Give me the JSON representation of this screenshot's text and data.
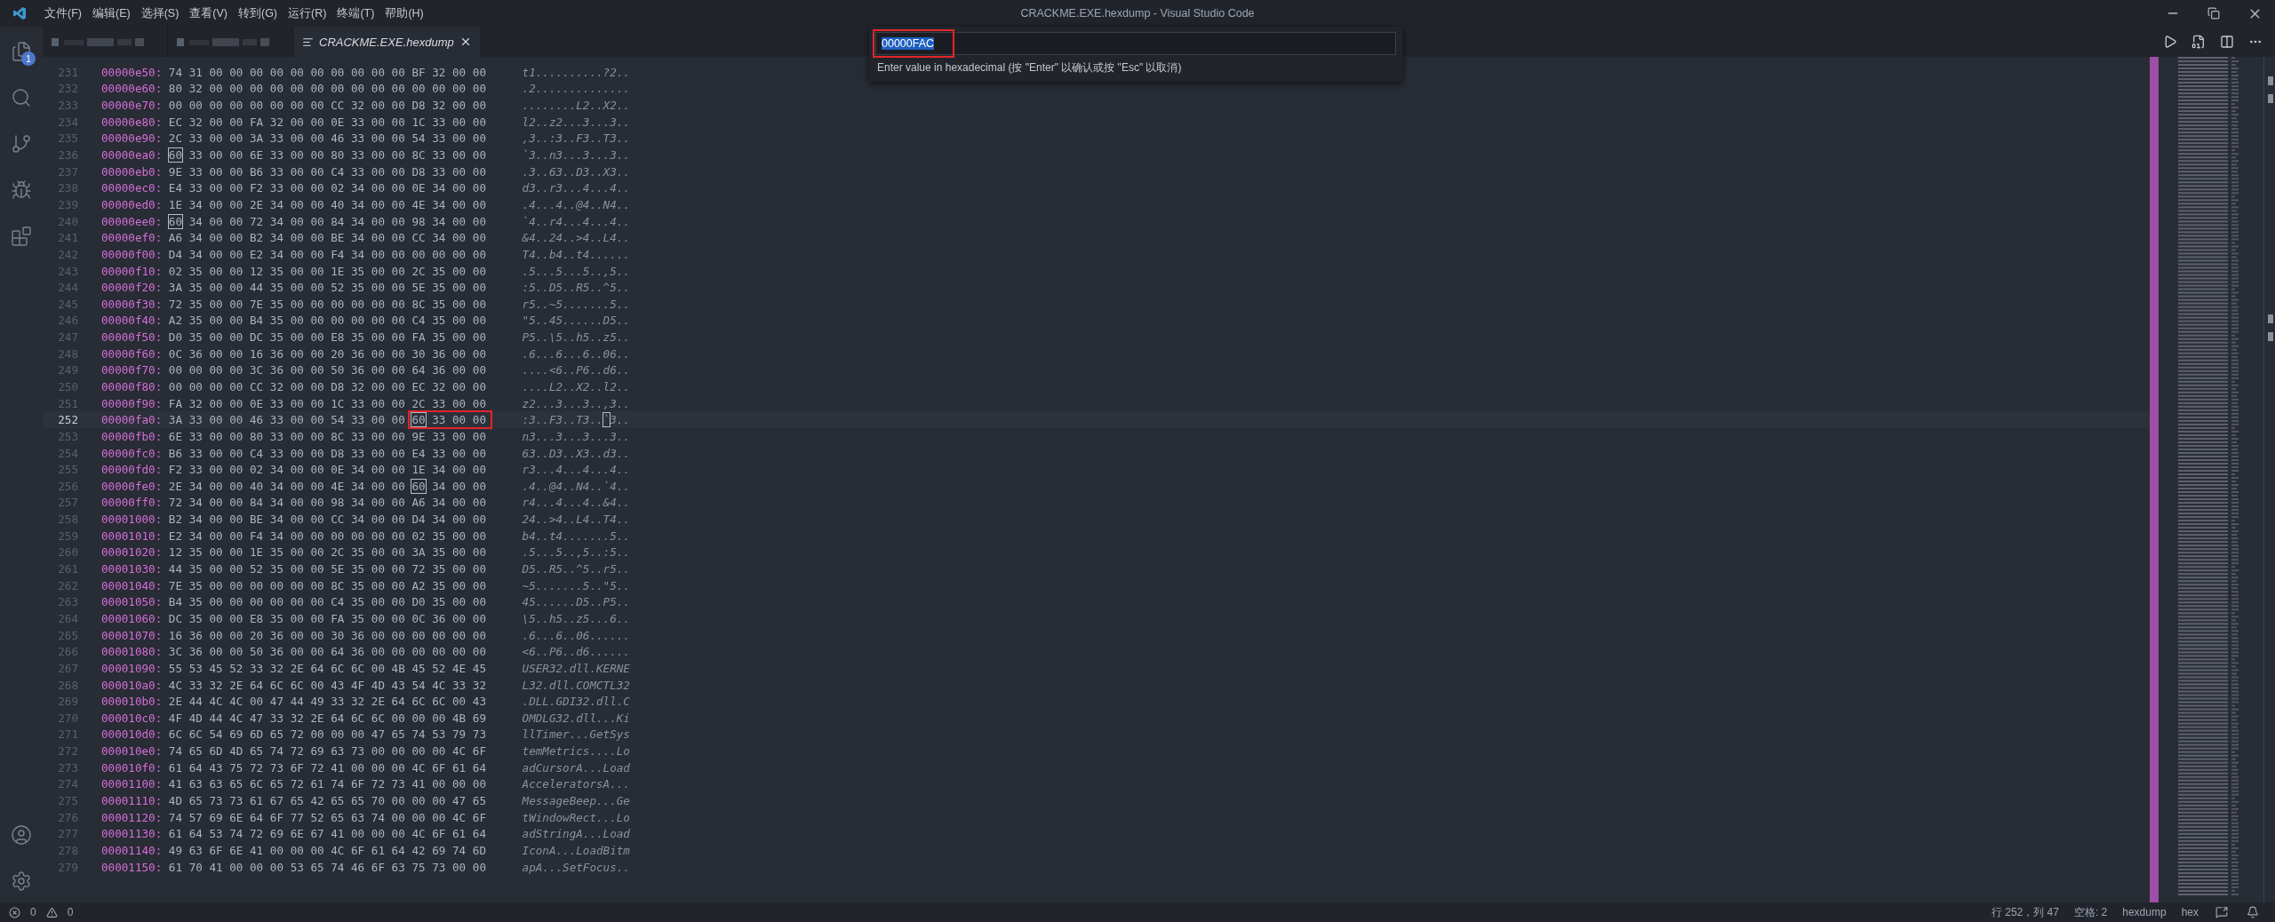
{
  "window": {
    "title": "CRACKME.EXE.hexdump - Visual Studio Code"
  },
  "menu": [
    "文件(F)",
    "编辑(E)",
    "选择(S)",
    "查看(V)",
    "转到(G)",
    "运行(R)",
    "终端(T)",
    "帮助(H)"
  ],
  "activity_bar": {
    "explorer_badge": "1"
  },
  "tabs": [
    {
      "kind": "redacted",
      "selected": false
    },
    {
      "kind": "redacted",
      "selected": false
    },
    {
      "kind": "file",
      "label": "CRACKME.EXE.hexdump",
      "selected": true
    }
  ],
  "quick_input": {
    "value": "00000FAC",
    "text_selected": true,
    "annotated": true,
    "hint": "Enter value in hexadecimal (按 \"Enter\" 以确认或按 \"Esc\" 以取消)"
  },
  "rows": [
    {
      "line": "231",
      "offset": "00000e50:",
      "bytes": "74 31 00 00 00 00 00 00 00 00 00 00 BF 32 00 00",
      "ascii": "t1..........?2.."
    },
    {
      "line": "232",
      "offset": "00000e60:",
      "bytes": "80 32 00 00 00 00 00 00 00 00 00 00 00 00 00 00",
      "ascii": ".2.............."
    },
    {
      "line": "233",
      "offset": "00000e70:",
      "bytes": "00 00 00 00 00 00 00 00 CC 32 00 00 D8 32 00 00",
      "ascii": "........L2..X2.."
    },
    {
      "line": "234",
      "offset": "00000e80:",
      "bytes": "EC 32 00 00 FA 32 00 00 0E 33 00 00 1C 33 00 00",
      "ascii": "l2..z2...3...3.."
    },
    {
      "line": "235",
      "offset": "00000e90:",
      "bytes": "2C 33 00 00 3A 33 00 00 46 33 00 00 54 33 00 00",
      "ascii": ",3..:3..F3..T3.."
    },
    {
      "line": "236",
      "offset": "00000ea0:",
      "bytes": [
        {
          "value": "60",
          "boxed": true
        },
        {
          "value": "33 00 00 6E 33 00 00 80 33 00 00 8C 33 00 00",
          "boxed": false
        }
      ],
      "ascii": "`3..n3...3...3.."
    },
    {
      "line": "237",
      "offset": "00000eb0:",
      "bytes": "9E 33 00 00 B6 33 00 00 C4 33 00 00 D8 33 00 00",
      "ascii": ".3..63..D3..X3.."
    },
    {
      "line": "238",
      "offset": "00000ec0:",
      "bytes": "E4 33 00 00 F2 33 00 00 02 34 00 00 0E 34 00 00",
      "ascii": "d3..r3...4...4.."
    },
    {
      "line": "239",
      "offset": "00000ed0:",
      "bytes": "1E 34 00 00 2E 34 00 00 40 34 00 00 4E 34 00 00",
      "ascii": ".4...4..@4..N4.."
    },
    {
      "line": "240",
      "offset": "00000ee0:",
      "bytes": [
        {
          "value": "60",
          "boxed": true
        },
        {
          "value": "34 00 00 72 34 00 00 84 34 00 00 98 34 00 00",
          "boxed": false
        }
      ],
      "ascii": "`4..r4...4...4.."
    },
    {
      "line": "241",
      "offset": "00000ef0:",
      "bytes": "A6 34 00 00 B2 34 00 00 BE 34 00 00 CC 34 00 00",
      "ascii": "&4..24..>4..L4.."
    },
    {
      "line": "242",
      "offset": "00000f00:",
      "bytes": "D4 34 00 00 E2 34 00 00 F4 34 00 00 00 00 00 00",
      "ascii": "T4..b4..t4......"
    },
    {
      "line": "243",
      "offset": "00000f10:",
      "bytes": "02 35 00 00 12 35 00 00 1E 35 00 00 2C 35 00 00",
      "ascii": ".5...5...5..,5.."
    },
    {
      "line": "244",
      "offset": "00000f20:",
      "bytes": "3A 35 00 00 44 35 00 00 52 35 00 00 5E 35 00 00",
      "ascii": ":5..D5..R5..^5.."
    },
    {
      "line": "245",
      "offset": "00000f30:",
      "bytes": "72 35 00 00 7E 35 00 00 00 00 00 00 8C 35 00 00",
      "ascii": "r5..~5.......5.."
    },
    {
      "line": "246",
      "offset": "00000f40:",
      "bytes": "A2 35 00 00 B4 35 00 00 00 00 00 00 C4 35 00 00",
      "ascii": "\"5..45......D5.."
    },
    {
      "line": "247",
      "offset": "00000f50:",
      "bytes": "D0 35 00 00 DC 35 00 00 E8 35 00 00 FA 35 00 00",
      "ascii": "P5..\\5..h5..z5.."
    },
    {
      "line": "248",
      "offset": "00000f60:",
      "bytes": "0C 36 00 00 16 36 00 00 20 36 00 00 30 36 00 00",
      "ascii": ".6...6...6..06.."
    },
    {
      "line": "249",
      "offset": "00000f70:",
      "bytes": "00 00 00 00 3C 36 00 00 50 36 00 00 64 36 00 00",
      "ascii": "....<6..P6..d6.."
    },
    {
      "line": "250",
      "offset": "00000f80:",
      "bytes": "00 00 00 00 CC 32 00 00 D8 32 00 00 EC 32 00 00",
      "ascii": "....L2..X2..l2.."
    },
    {
      "line": "251",
      "offset": "00000f90:",
      "bytes": "FA 32 00 00 0E 33 00 00 1C 33 00 00 2C 33 00 00",
      "ascii": "z2...3...3..,3.."
    },
    {
      "line": "252",
      "offset": "00000fa0:",
      "bytes": [
        {
          "value": "3A 33 00 00 46 33 00 00 54 33 00 00",
          "boxed": false
        },
        {
          "value": "60",
          "boxed": true,
          "annotated": true
        },
        {
          "value": "33 00 00",
          "boxed": false,
          "annotated": true
        }
      ],
      "ascii": [
        {
          "text": ":3..F3..T3..",
          "cursor": false
        },
        {
          "text": "`",
          "cursor": true
        },
        {
          "text": "3..",
          "cursor": false
        }
      ],
      "current": true
    },
    {
      "line": "253",
      "offset": "00000fb0:",
      "bytes": "6E 33 00 00 80 33 00 00 8C 33 00 00 9E 33 00 00",
      "ascii": "n3...3...3...3.."
    },
    {
      "line": "254",
      "offset": "00000fc0:",
      "bytes": "B6 33 00 00 C4 33 00 00 D8 33 00 00 E4 33 00 00",
      "ascii": "63..D3..X3..d3.."
    },
    {
      "line": "255",
      "offset": "00000fd0:",
      "bytes": "F2 33 00 00 02 34 00 00 0E 34 00 00 1E 34 00 00",
      "ascii": "r3...4...4...4.."
    },
    {
      "line": "256",
      "offset": "00000fe0:",
      "bytes": [
        {
          "value": "2E 34 00 00 40 34 00 00 4E 34 00 00",
          "boxed": false
        },
        {
          "value": "60",
          "boxed": true
        },
        {
          "value": "34 00 00",
          "boxed": false
        }
      ],
      "ascii": ".4..@4..N4..`4.."
    },
    {
      "line": "257",
      "offset": "00000ff0:",
      "bytes": "72 34 00 00 84 34 00 00 98 34 00 00 A6 34 00 00",
      "ascii": "r4...4...4..&4.."
    },
    {
      "line": "258",
      "offset": "00001000:",
      "bytes": "B2 34 00 00 BE 34 00 00 CC 34 00 00 D4 34 00 00",
      "ascii": "24..>4..L4..T4.."
    },
    {
      "line": "259",
      "offset": "00001010:",
      "bytes": "E2 34 00 00 F4 34 00 00 00 00 00 00 02 35 00 00",
      "ascii": "b4..t4.......5.."
    },
    {
      "line": "260",
      "offset": "00001020:",
      "bytes": "12 35 00 00 1E 35 00 00 2C 35 00 00 3A 35 00 00",
      "ascii": ".5...5..,5..:5.."
    },
    {
      "line": "261",
      "offset": "00001030:",
      "bytes": "44 35 00 00 52 35 00 00 5E 35 00 00 72 35 00 00",
      "ascii": "D5..R5..^5..r5.."
    },
    {
      "line": "262",
      "offset": "00001040:",
      "bytes": "7E 35 00 00 00 00 00 00 8C 35 00 00 A2 35 00 00",
      "ascii": "~5.......5..\"5.."
    },
    {
      "line": "263",
      "offset": "00001050:",
      "bytes": "B4 35 00 00 00 00 00 00 C4 35 00 00 D0 35 00 00",
      "ascii": "45......D5..P5.."
    },
    {
      "line": "264",
      "offset": "00001060:",
      "bytes": "DC 35 00 00 E8 35 00 00 FA 35 00 00 0C 36 00 00",
      "ascii": "\\5..h5..z5...6.."
    },
    {
      "line": "265",
      "offset": "00001070:",
      "bytes": "16 36 00 00 20 36 00 00 30 36 00 00 00 00 00 00",
      "ascii": ".6...6..06......"
    },
    {
      "line": "266",
      "offset": "00001080:",
      "bytes": "3C 36 00 00 50 36 00 00 64 36 00 00 00 00 00 00",
      "ascii": "<6..P6..d6......"
    },
    {
      "line": "267",
      "offset": "00001090:",
      "bytes": "55 53 45 52 33 32 2E 64 6C 6C 00 4B 45 52 4E 45",
      "ascii": "USER32.dll.KERNE"
    },
    {
      "line": "268",
      "offset": "000010a0:",
      "bytes": "4C 33 32 2E 64 6C 6C 00 43 4F 4D 43 54 4C 33 32",
      "ascii": "L32.dll.COMCTL32"
    },
    {
      "line": "269",
      "offset": "000010b0:",
      "bytes": "2E 44 4C 4C 00 47 44 49 33 32 2E 64 6C 6C 00 43",
      "ascii": ".DLL.GDI32.dll.C"
    },
    {
      "line": "270",
      "offset": "000010c0:",
      "bytes": "4F 4D 44 4C 47 33 32 2E 64 6C 6C 00 00 00 4B 69",
      "ascii": "OMDLG32.dll...Ki"
    },
    {
      "line": "271",
      "offset": "000010d0:",
      "bytes": "6C 6C 54 69 6D 65 72 00 00 00 47 65 74 53 79 73",
      "ascii": "llTimer...GetSys"
    },
    {
      "line": "272",
      "offset": "000010e0:",
      "bytes": "74 65 6D 4D 65 74 72 69 63 73 00 00 00 00 4C 6F",
      "ascii": "temMetrics....Lo"
    },
    {
      "line": "273",
      "offset": "000010f0:",
      "bytes": "61 64 43 75 72 73 6F 72 41 00 00 00 4C 6F 61 64",
      "ascii": "adCursorA...Load"
    },
    {
      "line": "274",
      "offset": "00001100:",
      "bytes": "41 63 63 65 6C 65 72 61 74 6F 72 73 41 00 00 00",
      "ascii": "AcceleratorsA..."
    },
    {
      "line": "275",
      "offset": "00001110:",
      "bytes": "4D 65 73 73 61 67 65 42 65 65 70 00 00 00 47 65",
      "ascii": "MessageBeep...Ge"
    },
    {
      "line": "276",
      "offset": "00001120:",
      "bytes": "74 57 69 6E 64 6F 77 52 65 63 74 00 00 00 4C 6F",
      "ascii": "tWindowRect...Lo"
    },
    {
      "line": "277",
      "offset": "00001130:",
      "bytes": "61 64 53 74 72 69 6E 67 41 00 00 00 4C 6F 61 64",
      "ascii": "adStringA...Load"
    },
    {
      "line": "278",
      "offset": "00001140:",
      "bytes": "49 63 6F 6E 41 00 00 00 4C 6F 61 64 42 69 74 6D",
      "ascii": "IconA...LoadBitm"
    },
    {
      "line": "279",
      "offset": "00001150:",
      "bytes": "61 70 41 00 00 00 53 65 74 46 6F 63 75 73 00 00",
      "ascii": "apA...SetFocus.."
    }
  ],
  "status_bar": {
    "errors": "0",
    "warnings": "0",
    "items": [
      "行 252，列 47",
      "空格: 2",
      "hexdump",
      "hex"
    ]
  }
}
